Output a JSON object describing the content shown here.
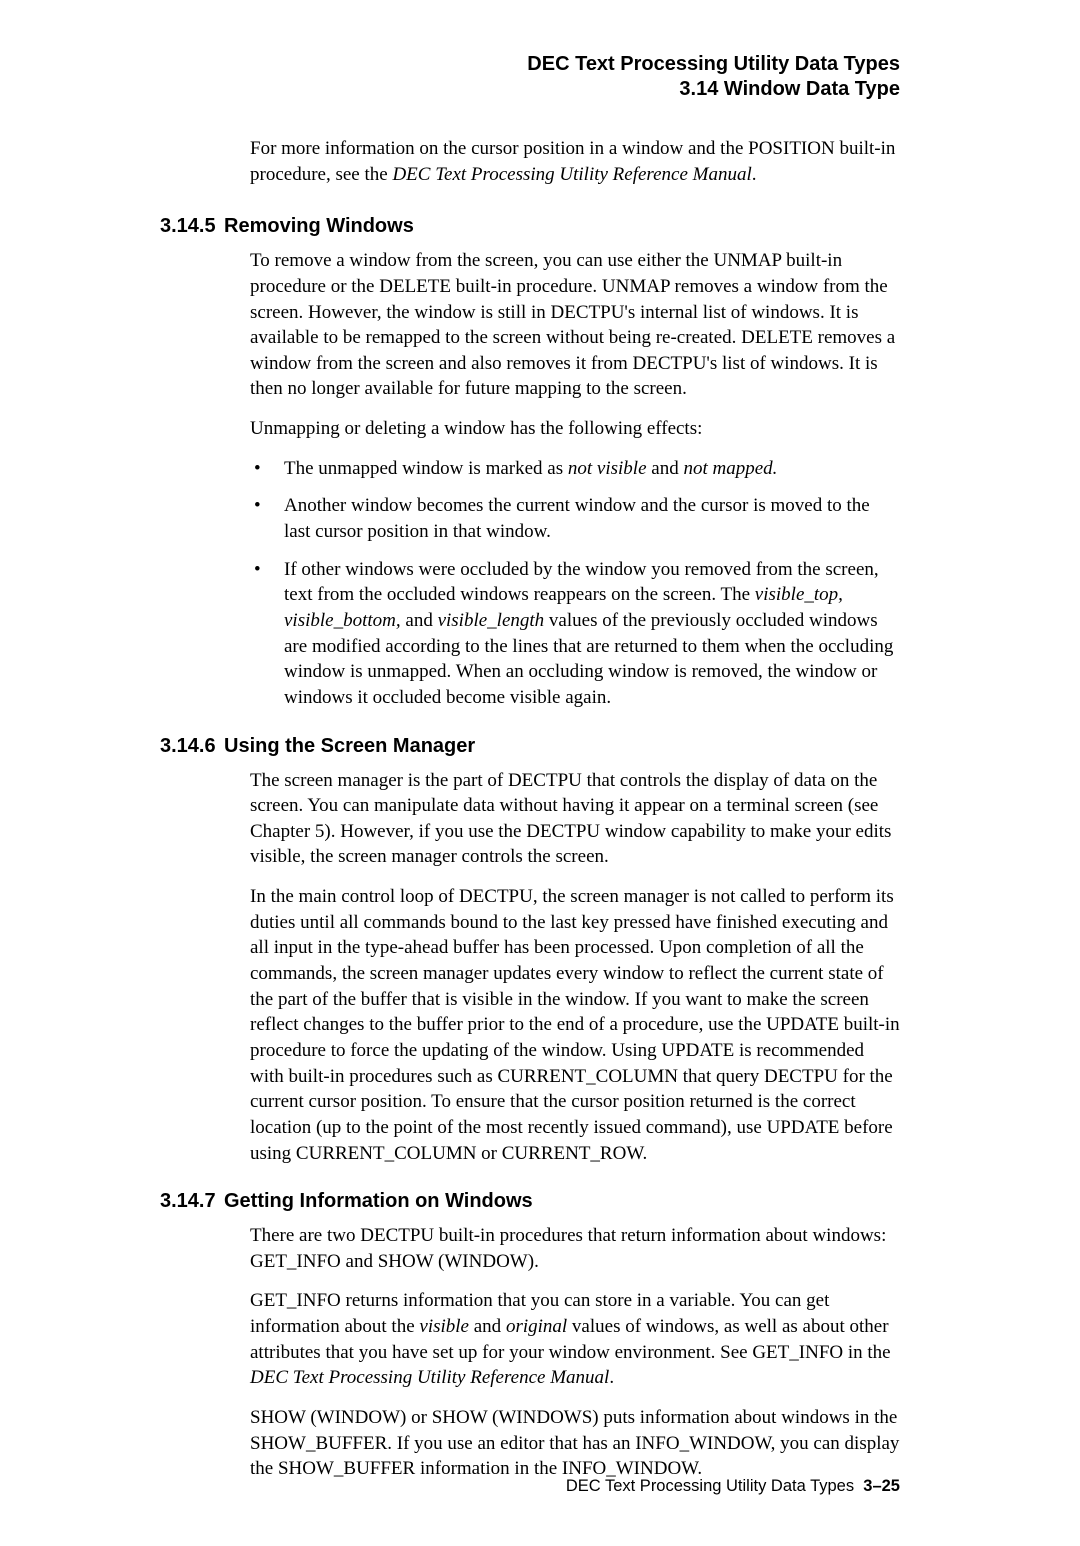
{
  "header": {
    "line1": "DEC Text Processing Utility Data Types",
    "line2": "3.14 Window Data Type"
  },
  "intro": {
    "para1_a": "For more information on the cursor position in a window and the POSITION built-in procedure, see the ",
    "para1_em": "DEC Text Processing Utility Reference Manual",
    "para1_b": "."
  },
  "s1": {
    "num": "3.14.5",
    "title": "Removing Windows",
    "p1": "To remove a window from the screen, you can use either the UNMAP built-in procedure or the DELETE built-in procedure. UNMAP removes a window from the screen. However, the window is still in DECTPU's internal list of windows. It is available to be remapped to the screen without being re-created. DELETE removes a window from the screen and also removes it from DECTPU's list of windows. It is then no longer available for future mapping to the screen.",
    "p2": "Unmapping or deleting a window has the following effects:",
    "b1_a": "The unmapped window is marked as ",
    "b1_em1": "not visible",
    "b1_mid": " and ",
    "b1_em2": "not mapped.",
    "b2": "Another window becomes the current window and the cursor is moved to the last cursor position in that window.",
    "b3_a": "If other windows were occluded by the window you removed from the screen, text from the occluded windows reappears on the screen. The ",
    "b3_em1": "visible_top, visible_bottom,",
    "b3_mid": " and ",
    "b3_em2": "visible_length",
    "b3_b": " values of the previously occluded windows are modified according to the lines that are returned to them when the occluding window is unmapped. When an occluding window is removed, the window or windows it occluded become visible again."
  },
  "s2": {
    "num": "3.14.6",
    "title": "Using the Screen Manager",
    "p1": "The screen manager is the part of DECTPU that controls the display of data on the screen. You can manipulate data without having it appear on a terminal screen (see Chapter 5). However, if you use the DECTPU window capability to make your edits visible, the screen manager controls the screen.",
    "p2": "In the main control loop of DECTPU, the screen manager is not called to perform its duties until all commands bound to the last key pressed have finished executing and all input in the type-ahead buffer has been processed. Upon completion of all the commands, the screen manager updates every window to reflect the current state of the part of the buffer that is visible in the window. If you want to make the screen reflect changes to the buffer prior to the end of a procedure, use the UPDATE built-in procedure to force the updating of the window. Using UPDATE is recommended with built-in procedures such as CURRENT_COLUMN that query DECTPU for the current cursor position. To ensure that the cursor position returned is the correct location (up to the point of the most recently issued command), use UPDATE before using CURRENT_COLUMN or CURRENT_ROW."
  },
  "s3": {
    "num": "3.14.7",
    "title": "Getting Information on Windows",
    "p1": "There are two DECTPU built-in procedures that return information about windows: GET_INFO and SHOW (WINDOW).",
    "p2_a": "GET_INFO returns information that you can store in a variable. You can get information about the ",
    "p2_em1": "visible",
    "p2_mid1": " and ",
    "p2_em2": "original",
    "p2_mid2": " values of windows, as well as about other attributes that you have set up for your window environment. See GET_INFO in the ",
    "p2_em3": "DEC Text Processing Utility Reference Manual",
    "p2_b": ".",
    "p3": "SHOW (WINDOW) or SHOW (WINDOWS) puts information about windows in the SHOW_BUFFER. If you use an editor that has an INFO_WINDOW, you can display the SHOW_BUFFER information in the INFO_WINDOW."
  },
  "footer": {
    "label": "DEC Text Processing Utility Data Types",
    "page": "3–25"
  }
}
